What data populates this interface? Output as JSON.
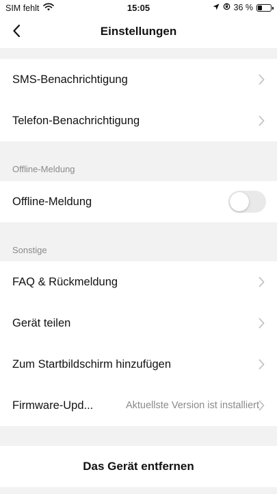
{
  "status_bar": {
    "carrier": "SIM fehlt",
    "time": "15:05",
    "battery_percent": "36 %",
    "battery_level": 0.36
  },
  "nav": {
    "title": "Einstellungen"
  },
  "notifications": {
    "items": [
      {
        "label": "SMS-Benachrichtigung"
      },
      {
        "label": "Telefon-Benachrichtigung"
      }
    ]
  },
  "offline_section": {
    "header": "Offline-Meldung",
    "toggle_label": "Offline-Meldung",
    "toggle_on": false
  },
  "other_section": {
    "header": "Sonstige",
    "items": [
      {
        "label": "FAQ & Rückmeldung"
      },
      {
        "label": "Gerät teilen"
      },
      {
        "label": "Zum Startbildschirm hinzufügen"
      },
      {
        "label": "Firmware-Upd...",
        "value": "Aktuellste Version ist installiert"
      }
    ]
  },
  "remove_button": "Das Gerät entfernen"
}
